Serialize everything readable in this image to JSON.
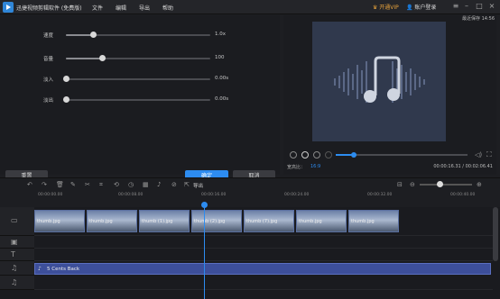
{
  "app": {
    "title": "迅捷视频剪辑软件 (免费版)",
    "menus": [
      "文件",
      "编辑",
      "导出",
      "帮助"
    ],
    "vip_label": "开通VIP",
    "account_label": "账户登录"
  },
  "editor": {
    "sliders": [
      {
        "label": "速度",
        "value": "1.0x",
        "level": 0.19
      },
      {
        "label": "音量",
        "value": "100",
        "level": 0.25
      },
      {
        "label": "淡入",
        "value": "0.00s",
        "level": 0.0
      },
      {
        "label": "淡出",
        "value": "0.00s",
        "level": 0.0
      }
    ],
    "reset_label": "重置",
    "ok_label": "确定",
    "cancel_label": "取消"
  },
  "preview": {
    "label": "最近保存 14:56",
    "ratio_label": "宽高比：",
    "ratio_value": "16:9",
    "time_readout": "00:00:16.31 / 00:02:06.41",
    "progress": 0.14,
    "screen_color": "#30394d"
  },
  "toolbar": {
    "export_label": "导出"
  },
  "ruler": {
    "labels": [
      "00:00:00.00",
      "00:00:08.00",
      "00:00:16.00",
      "00:00:24.00",
      "00:00:32.00",
      "00:00:40.00"
    ]
  },
  "clips": [
    {
      "name": "thumb.jpg"
    },
    {
      "name": "thumb.jpg"
    },
    {
      "name": "thumb (1).jpg"
    },
    {
      "name": "thumb (2).jpg"
    },
    {
      "name": "thumb (7).jpg"
    },
    {
      "name": "thumb.jpg"
    },
    {
      "name": "thumb.jpg"
    }
  ],
  "audio": {
    "name": "5 Cents Back"
  },
  "colors": {
    "accent": "#2d8cf0",
    "vip": "#e6a23c"
  }
}
